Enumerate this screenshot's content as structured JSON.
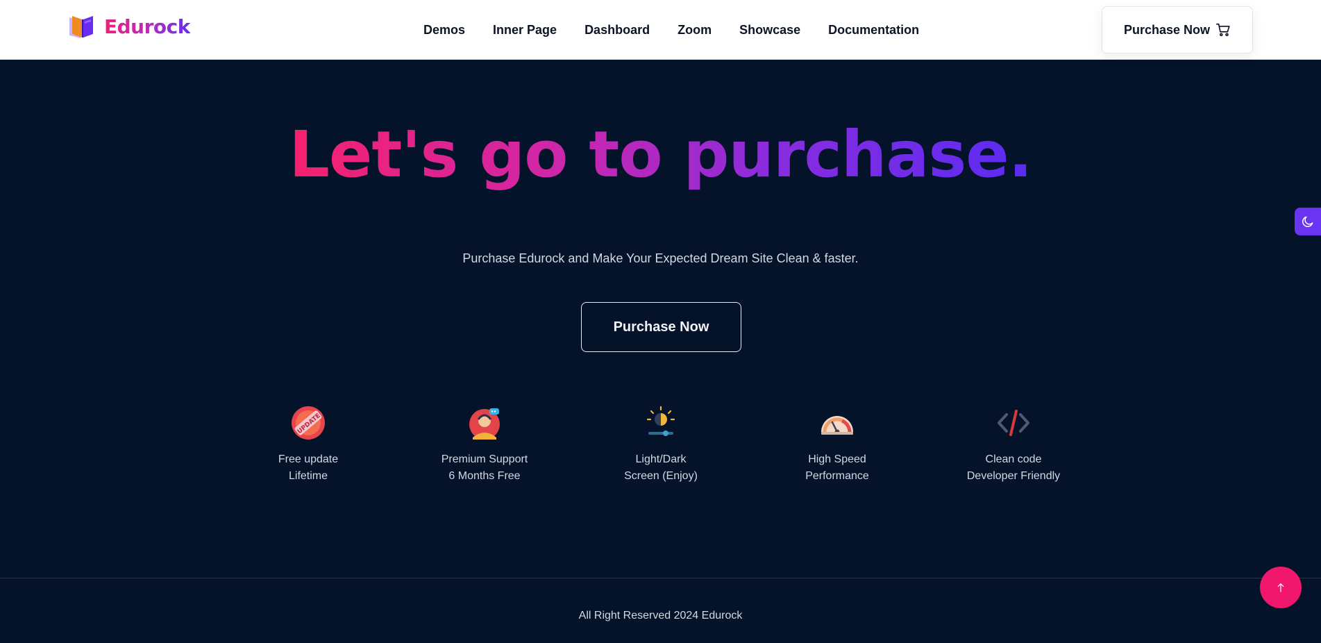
{
  "brand": {
    "name": "Edurock",
    "logo_icon": "open-book-logo"
  },
  "nav": {
    "links": [
      {
        "label": "Demos"
      },
      {
        "label": "Inner Page"
      },
      {
        "label": "Dashboard"
      },
      {
        "label": "Zoom"
      },
      {
        "label": "Showcase"
      },
      {
        "label": "Documentation"
      }
    ],
    "purchase_label": "Purchase Now",
    "purchase_icon": "cart-icon"
  },
  "hero": {
    "title": "Let's go to purchase.",
    "subtitle": "Purchase Edurock and Make Your Expected Dream Site Clean & faster.",
    "button_label": "Purchase Now"
  },
  "features": [
    {
      "icon": "update-badge-icon",
      "line1": "Free update",
      "line2": "Lifetime"
    },
    {
      "icon": "support-agent-icon",
      "line1": "Premium Support",
      "line2": "6 Months Free"
    },
    {
      "icon": "sun-slider-icon",
      "line1": "Light/Dark",
      "line2": "Screen (Enjoy)"
    },
    {
      "icon": "speedometer-icon",
      "line1": "High Speed",
      "line2": "Performance"
    },
    {
      "icon": "code-icon",
      "line1": "Clean code",
      "line2": "Developer Friendly"
    }
  ],
  "footer": {
    "copyright": "All Right Reserved 2024 Edurock"
  },
  "floating": {
    "mode_toggle_icon": "moon-icon",
    "scroll_top_icon": "arrow-up-icon"
  },
  "colors": {
    "page_background": "#04132a",
    "navbar_background": "#ffffff",
    "brand_pink": "#ef1f78",
    "brand_purple": "#6a2cf0",
    "toggle_purple": "#6a35f2",
    "scroll_top_pink": "#f0176c"
  }
}
